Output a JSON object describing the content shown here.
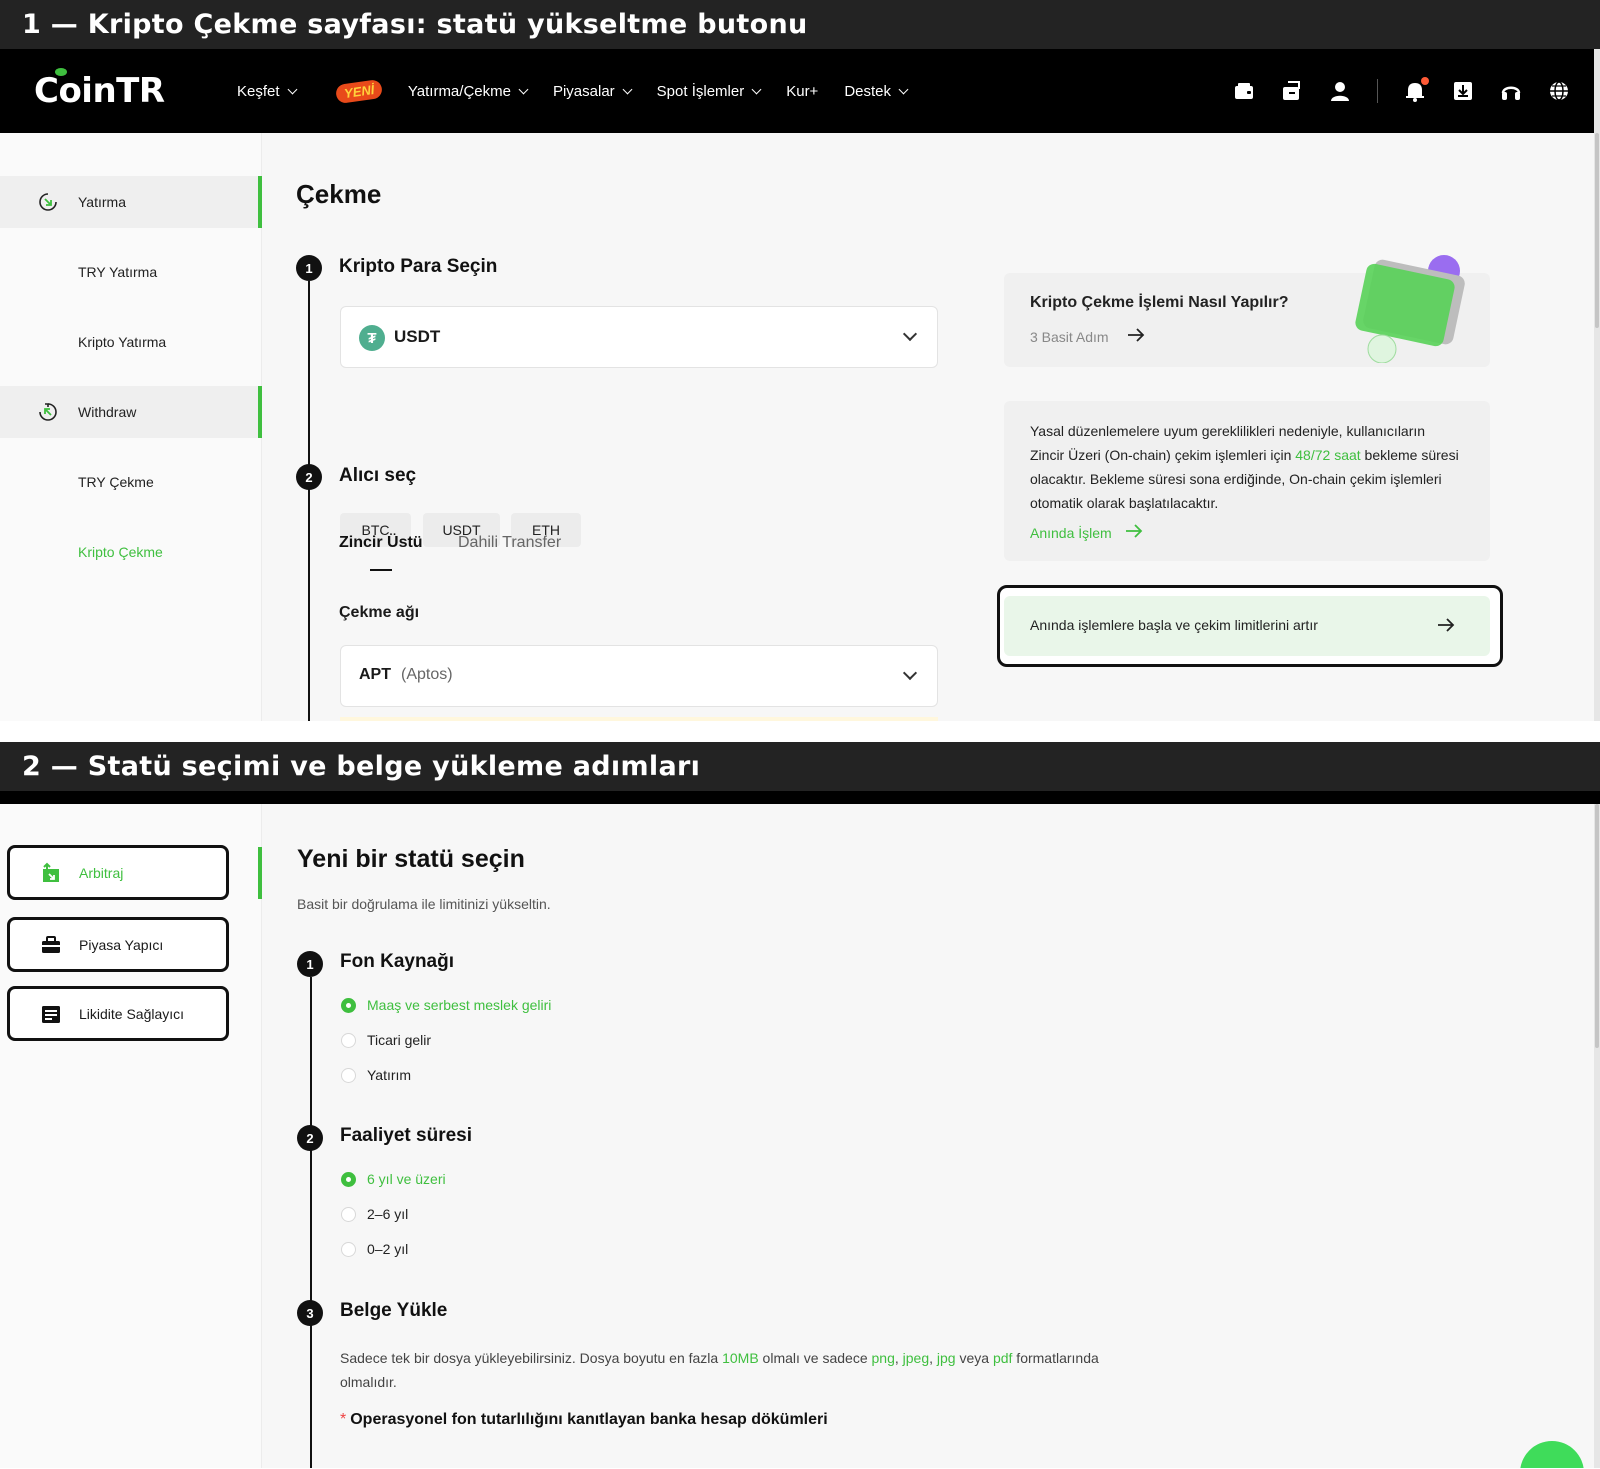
{
  "panel1": {
    "title": "1 — Kripto Çekme sayfası: statü yükseltme butonu"
  },
  "panel2": {
    "title": "2 — Statü seçimi ve belge yükleme adımları"
  },
  "topnav": {
    "logo": "CoinTR",
    "items": [
      {
        "label": "Keşfet"
      },
      {
        "label": "Yatırma/Çekme"
      },
      {
        "label": "Piyasalar"
      },
      {
        "label": "Spot İşlemler"
      },
      {
        "label": "Kur+"
      },
      {
        "label": "Destek"
      }
    ],
    "badge": "YENİ",
    "icons": [
      "wallet-icon",
      "exchange-icon",
      "user-icon",
      "bell-icon",
      "download-icon",
      "headset-icon",
      "globe-icon"
    ]
  },
  "sidebar": {
    "items": [
      {
        "label": "Yatırma",
        "icon": "deposit-icon"
      },
      {
        "label": "TRY Yatırma"
      },
      {
        "label": "Kripto Yatırma"
      },
      {
        "label": "Withdraw",
        "icon": "withdraw-icon"
      },
      {
        "label": "TRY Çekme"
      },
      {
        "label": "Kripto Çekme"
      }
    ]
  },
  "withdraw": {
    "title": "Çekme",
    "step1": {
      "num": "1",
      "label": "Kripto Para Seçin"
    },
    "selected_coin": "USDT",
    "coin_chips": [
      "BTC",
      "USDT",
      "ETH"
    ],
    "step2": {
      "num": "2",
      "label": "Alıcı seç"
    },
    "tabs": [
      "Zincir Üstü",
      "Dahili Transfer"
    ],
    "network_label": "Çekme ağı",
    "network_value": "APT",
    "network_desc": "(Aptos)"
  },
  "howto": {
    "title": "Kripto Çekme İşlemi Nasıl Yapılır?",
    "sub": "3 Basit Adım"
  },
  "notice": {
    "text_a": "Yasal düzenlemelere uyum gereklilikleri nedeniyle, kullanıcıların Zincir Üzeri (On-chain) çekim işlemleri için ",
    "highlight": "48/72 saat",
    "text_b": " bekleme süresi olacaktır. Bekleme süresi sona erdiğinde, On-chain çekim işlemleri otomatik olarak başlatılacaktır.",
    "link": "Anında İşlem"
  },
  "upgrade": {
    "label": "Anında işlemlere başla ve çekim limitlerini artır"
  },
  "status": {
    "title": "Yeni bir statü seçin",
    "subtitle": "Basit bir doğrulama ile limitinizi yükseltin.",
    "options": [
      {
        "label": "Arbitraj",
        "icon": "arbitrage-icon"
      },
      {
        "label": "Piyasa Yapıcı",
        "icon": "briefcase-icon"
      },
      {
        "label": "Likidite Sağlayıcı",
        "icon": "liquidity-icon"
      }
    ]
  },
  "steps": {
    "fund": {
      "num": "1",
      "label": "Fon Kaynağı",
      "options": [
        "Maaş ve serbest meslek geliri",
        "Ticari gelir",
        "Yatırım"
      ]
    },
    "duration": {
      "num": "2",
      "label": "Faaliyet süresi",
      "options": [
        "6 yıl ve üzeri",
        "2–6 yıl",
        "0–2 yıl"
      ]
    },
    "upload": {
      "num": "3",
      "label": "Belge Yükle",
      "desc_a": "Sadece tek bir dosya yükleyebilirsiniz. Dosya boyutu en fazla ",
      "size": "10MB",
      "desc_b": " olmalı ve sadece ",
      "fmt1": "png",
      "fmt2": "jpeg",
      "fmt3": "jpg",
      "desc_c": " veya ",
      "fmt4": "pdf",
      "desc_d": " formatlarında olmalıdır.",
      "required_star": "*",
      "doc_label": "Operasyonel fon tutarlılığını kanıtlayan banka hesap dökümleri"
    }
  },
  "colors": {
    "accent": "#3fbf3f",
    "dark": "#111111",
    "nav_bg": "#000000"
  }
}
